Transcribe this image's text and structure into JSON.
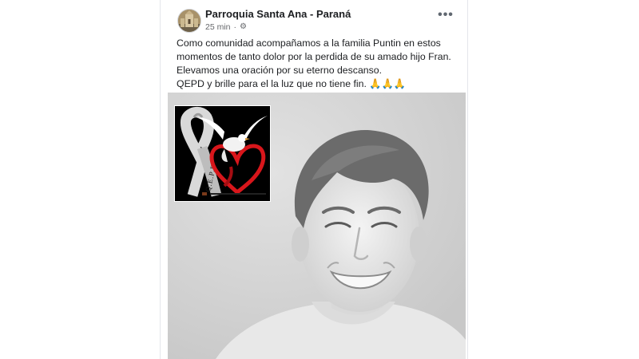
{
  "post": {
    "page_name": "Parroquia Santa Ana - Paraná",
    "time": "25 min",
    "separator": "·",
    "privacy_icon": "gear-icon",
    "more_icon": "more-options-icon",
    "text_lines": [
      "Como comunidad acompañamos a la familia Puntin en estos",
      "momentos de tanto dolor por la perdida de su amado hijo Fran.",
      "Elevamos una oración por su eterno descanso.",
      "QEPD y brille para el la luz que no tiene fin."
    ],
    "emoji": "🙏🙏🙏"
  },
  "inset": {
    "ribbon_text": "Q.E.P.D."
  },
  "colors": {
    "text": "#1c1e21",
    "meta": "#65676b",
    "heart": "#d8161b",
    "photo_bg": "#d6d6d6"
  }
}
